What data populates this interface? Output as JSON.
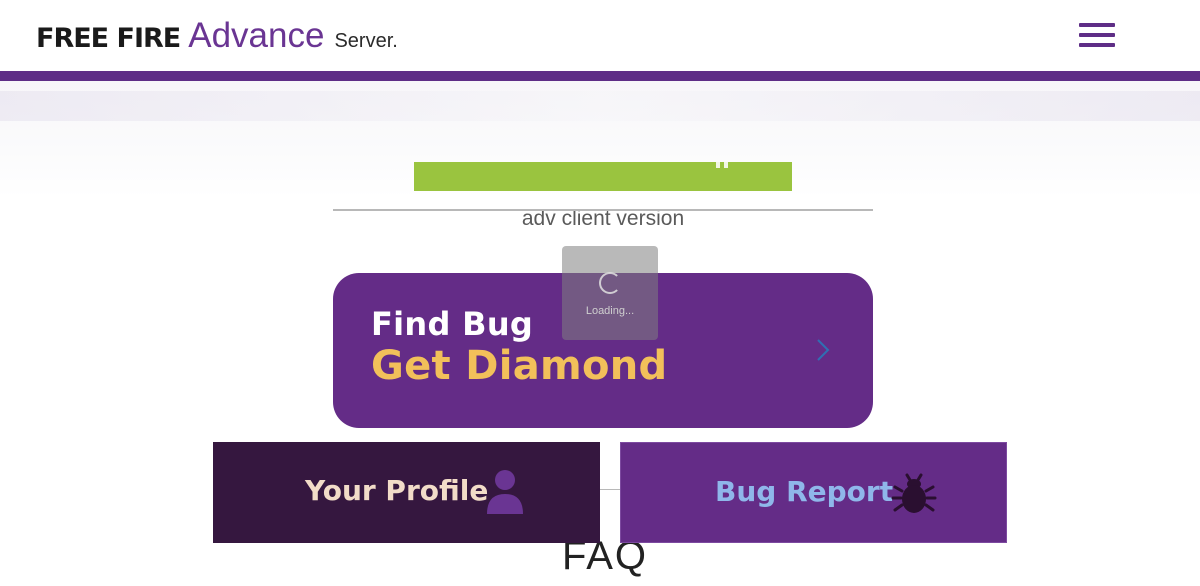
{
  "header": {
    "logo_freefire": "FREE FIRE",
    "logo_advance": "Advance",
    "logo_server": "Server.",
    "menu_icon": "hamburger-menu-icon"
  },
  "hero": {
    "version_text": "adv client version"
  },
  "find_bug": {
    "title": "Find Bug",
    "subtitle": "Get Diamond",
    "chevron_icon": "chevron-right-icon"
  },
  "loading": {
    "text": "Loading..."
  },
  "tiles": {
    "profile": {
      "label": "Your Profile",
      "icon": "user-icon"
    },
    "bug_report": {
      "label": "Bug Report",
      "icon": "bug-icon"
    }
  },
  "faq": {
    "title": "FAQ"
  },
  "colors": {
    "brand_purple": "#642c87",
    "header_bar": "#5e2d86",
    "download_green": "#9ac43f",
    "diamond_gold": "#f2c05a",
    "profile_tile": "#35173f",
    "bug_label_blue": "#8fb7ea"
  }
}
